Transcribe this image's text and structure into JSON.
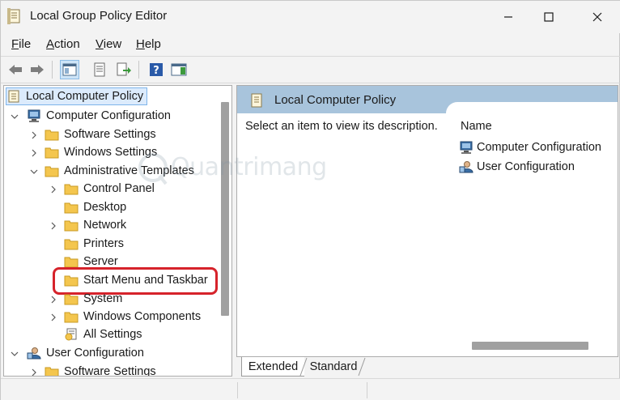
{
  "window": {
    "title": "Local Group Policy Editor"
  },
  "menu": {
    "items": [
      {
        "accel": "F",
        "rest": "ile"
      },
      {
        "accel": "A",
        "rest": "ction"
      },
      {
        "accel": "V",
        "rest": "iew"
      },
      {
        "accel": "H",
        "rest": "elp"
      }
    ]
  },
  "toolbar": {
    "icons": [
      "back-arrow-icon",
      "forward-arrow-icon",
      "show-hide-console-tree-icon",
      "properties-icon",
      "export-list-icon",
      "help-icon",
      "show-action-pane-icon"
    ]
  },
  "tree": {
    "root": "Local Computer Policy",
    "items": [
      {
        "label": "Computer Configuration",
        "level": 1,
        "expand": "expanded",
        "icon": "computer-icon"
      },
      {
        "label": "Software Settings",
        "level": 2,
        "expand": "collapsed",
        "icon": "folder-icon"
      },
      {
        "label": "Windows Settings",
        "level": 2,
        "expand": "collapsed",
        "icon": "folder-icon"
      },
      {
        "label": "Administrative Templates",
        "level": 2,
        "expand": "expanded",
        "icon": "folder-icon"
      },
      {
        "label": "Control Panel",
        "level": 3,
        "expand": "collapsed",
        "icon": "folder-icon"
      },
      {
        "label": "Desktop",
        "level": 3,
        "expand": "none",
        "icon": "folder-icon"
      },
      {
        "label": "Network",
        "level": 3,
        "expand": "collapsed",
        "icon": "folder-icon"
      },
      {
        "label": "Printers",
        "level": 3,
        "expand": "none",
        "icon": "folder-icon"
      },
      {
        "label": "Server",
        "level": 3,
        "expand": "none",
        "icon": "folder-icon"
      },
      {
        "label": "Start Menu and Taskbar",
        "level": 3,
        "expand": "none",
        "icon": "folder-icon",
        "highlighted": true
      },
      {
        "label": "System",
        "level": 3,
        "expand": "collapsed",
        "icon": "folder-icon"
      },
      {
        "label": "Windows Components",
        "level": 3,
        "expand": "collapsed",
        "icon": "folder-icon"
      },
      {
        "label": "All Settings",
        "level": 3,
        "expand": "none",
        "icon": "all-settings-icon"
      },
      {
        "label": "User Configuration",
        "level": 1,
        "expand": "expanded",
        "icon": "user-icon"
      },
      {
        "label": "Software Settings",
        "level": 2,
        "expand": "collapsed",
        "icon": "folder-icon"
      }
    ]
  },
  "details": {
    "title": "Local Computer Policy",
    "description": "Select an item to view its description.",
    "column_header": "Name",
    "items": [
      {
        "label": "Computer Configuration",
        "icon": "computer-icon"
      },
      {
        "label": "User Configuration",
        "icon": "user-icon"
      }
    ]
  },
  "tabs": [
    "Extended",
    "Standard"
  ],
  "watermark": {
    "text": "Quantrimang"
  },
  "colors": {
    "highlight": "#d6232b",
    "selected_bg": "#dcebfc",
    "header_bg": "#a8c4dc",
    "folder": "#f4c64e"
  }
}
